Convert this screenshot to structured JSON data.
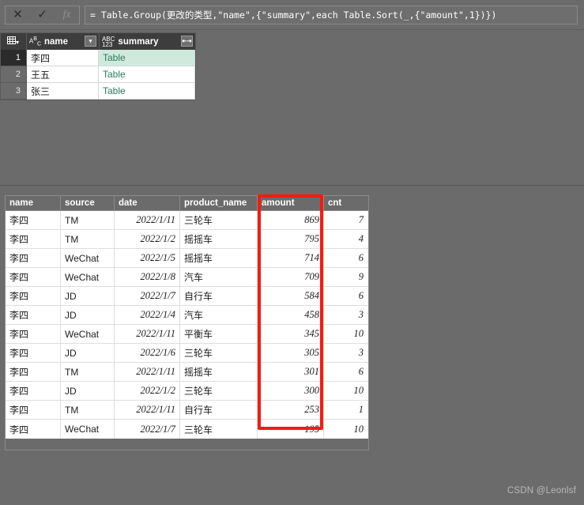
{
  "formula_bar": {
    "cancel_label": "✕",
    "accept_label": "✓",
    "fx_label": "fx",
    "formula": "= Table.Group(更改的类型,\"name\",{\"summary\",each Table.Sort(_,{\"amount\",1})})"
  },
  "top_grid": {
    "select_all_icon": "grid-icon",
    "columns": [
      {
        "label": "name",
        "type_icon_top": "A",
        "type_icon_sup": "B",
        "type_icon_sub": "C",
        "button": "▾"
      },
      {
        "label": "summary",
        "type_icon_top": "ABC",
        "type_icon_sub": "123",
        "button": "⇤⇥"
      }
    ],
    "rows": [
      {
        "num": "1",
        "name": "李四",
        "summary": "Table",
        "selected": true
      },
      {
        "num": "2",
        "name": "王五",
        "summary": "Table",
        "selected": false
      },
      {
        "num": "3",
        "name": "张三",
        "summary": "Table",
        "selected": false
      }
    ]
  },
  "detail_table": {
    "columns": [
      "name",
      "source",
      "date",
      "product_name",
      "amount",
      "cnt"
    ],
    "rows": [
      {
        "name": "李四",
        "source": "TM",
        "date": "2022/1/11",
        "product_name": "三轮车",
        "amount": "869",
        "cnt": "7"
      },
      {
        "name": "李四",
        "source": "TM",
        "date": "2022/1/2",
        "product_name": "摇摇车",
        "amount": "795",
        "cnt": "4"
      },
      {
        "name": "李四",
        "source": "WeChat",
        "date": "2022/1/5",
        "product_name": "摇摇车",
        "amount": "714",
        "cnt": "6"
      },
      {
        "name": "李四",
        "source": "WeChat",
        "date": "2022/1/8",
        "product_name": "汽车",
        "amount": "709",
        "cnt": "9"
      },
      {
        "name": "李四",
        "source": "JD",
        "date": "2022/1/7",
        "product_name": "自行车",
        "amount": "584",
        "cnt": "6"
      },
      {
        "name": "李四",
        "source": "JD",
        "date": "2022/1/4",
        "product_name": "汽车",
        "amount": "458",
        "cnt": "3"
      },
      {
        "name": "李四",
        "source": "WeChat",
        "date": "2022/1/11",
        "product_name": "平衡车",
        "amount": "345",
        "cnt": "10"
      },
      {
        "name": "李四",
        "source": "JD",
        "date": "2022/1/6",
        "product_name": "三轮车",
        "amount": "305",
        "cnt": "3"
      },
      {
        "name": "李四",
        "source": "TM",
        "date": "2022/1/11",
        "product_name": "摇摇车",
        "amount": "301",
        "cnt": "6"
      },
      {
        "name": "李四",
        "source": "JD",
        "date": "2022/1/2",
        "product_name": "三轮车",
        "amount": "300",
        "cnt": "10"
      },
      {
        "name": "李四",
        "source": "TM",
        "date": "2022/1/11",
        "product_name": "自行车",
        "amount": "253",
        "cnt": "1"
      },
      {
        "name": "李四",
        "source": "WeChat",
        "date": "2022/1/7",
        "product_name": "三轮车",
        "amount": "195",
        "cnt": "10"
      }
    ]
  },
  "annotation": {
    "highlight_color": "#f61b0c",
    "highlighted_column": "amount"
  },
  "watermark": {
    "text": "CSDN @Leonlsf"
  }
}
